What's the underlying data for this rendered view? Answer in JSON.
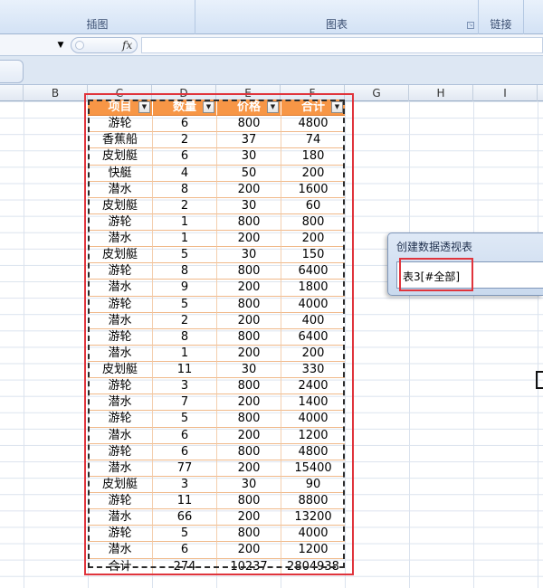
{
  "ribbon": {
    "groups": [
      {
        "label": "插图"
      },
      {
        "label": "图表"
      },
      {
        "label": "链接"
      }
    ]
  },
  "formula_bar": {
    "fx_label": "fx",
    "value": ""
  },
  "columns": [
    "B",
    "C",
    "D",
    "E",
    "F",
    "G",
    "H",
    "I"
  ],
  "table": {
    "headers": [
      "项目",
      "数量",
      "价格",
      "合计"
    ],
    "rows": [
      [
        "游轮",
        "6",
        "800",
        "4800"
      ],
      [
        "香蕉船",
        "2",
        "37",
        "74"
      ],
      [
        "皮划艇",
        "6",
        "30",
        "180"
      ],
      [
        "快艇",
        "4",
        "50",
        "200"
      ],
      [
        "潜水",
        "8",
        "200",
        "1600"
      ],
      [
        "皮划艇",
        "2",
        "30",
        "60"
      ],
      [
        "游轮",
        "1",
        "800",
        "800"
      ],
      [
        "潜水",
        "1",
        "200",
        "200"
      ],
      [
        "皮划艇",
        "5",
        "30",
        "150"
      ],
      [
        "游轮",
        "8",
        "800",
        "6400"
      ],
      [
        "潜水",
        "9",
        "200",
        "1800"
      ],
      [
        "游轮",
        "5",
        "800",
        "4000"
      ],
      [
        "潜水",
        "2",
        "200",
        "400"
      ],
      [
        "游轮",
        "8",
        "800",
        "6400"
      ],
      [
        "潜水",
        "1",
        "200",
        "200"
      ],
      [
        "皮划艇",
        "11",
        "30",
        "330"
      ],
      [
        "游轮",
        "3",
        "800",
        "2400"
      ],
      [
        "潜水",
        "7",
        "200",
        "1400"
      ],
      [
        "游轮",
        "5",
        "800",
        "4000"
      ],
      [
        "潜水",
        "6",
        "200",
        "1200"
      ],
      [
        "游轮",
        "6",
        "800",
        "4800"
      ],
      [
        "潜水",
        "77",
        "200",
        "15400"
      ],
      [
        "皮划艇",
        "3",
        "30",
        "90"
      ],
      [
        "游轮",
        "11",
        "800",
        "8800"
      ],
      [
        "潜水",
        "66",
        "200",
        "13200"
      ],
      [
        "游轮",
        "5",
        "800",
        "4000"
      ],
      [
        "潜水",
        "6",
        "200",
        "1200"
      ]
    ],
    "total": [
      "合计",
      "274",
      "10237",
      "2804938"
    ]
  },
  "dialog": {
    "title": "创建数据透视表",
    "range_value": "表3[#全部]"
  }
}
